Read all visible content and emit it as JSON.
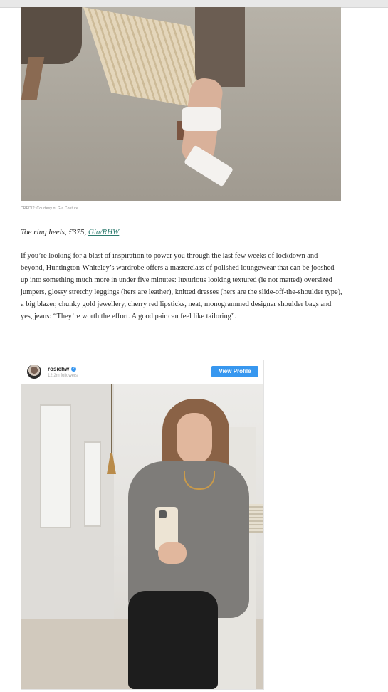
{
  "image_credit": "CREDIT: Courtesy of Gia Couture",
  "caption": {
    "text": "Toe ring heels, £375, ",
    "link": "Gia/RHW"
  },
  "body": {
    "paragraph": "If you’re looking for a blast of inspiration to power you through the last few weeks of lockdown and beyond, Huntington-Whiteley’s wardrobe offers a masterclass of polished loungewear that can be jooshed up into something much more in under five minutes: luxurious looking textured (ie not matted) oversized jumpers, glossy stretchy leggings (hers are leather), knitted dresses (hers are the slide-off-the-shoulder type), a big blazer, chunky gold jewellery, cherry red lipsticks, neat, monogrammed designer shoulder bags and yes, jeans: “They’re worth the effort. A good pair can feel like tailoring”."
  },
  "instagram": {
    "username": "rosiehw",
    "verified_glyph": "✓",
    "followers": "12.2m followers",
    "view_profile_label": "View Profile",
    "button_color": "#3797ef"
  }
}
